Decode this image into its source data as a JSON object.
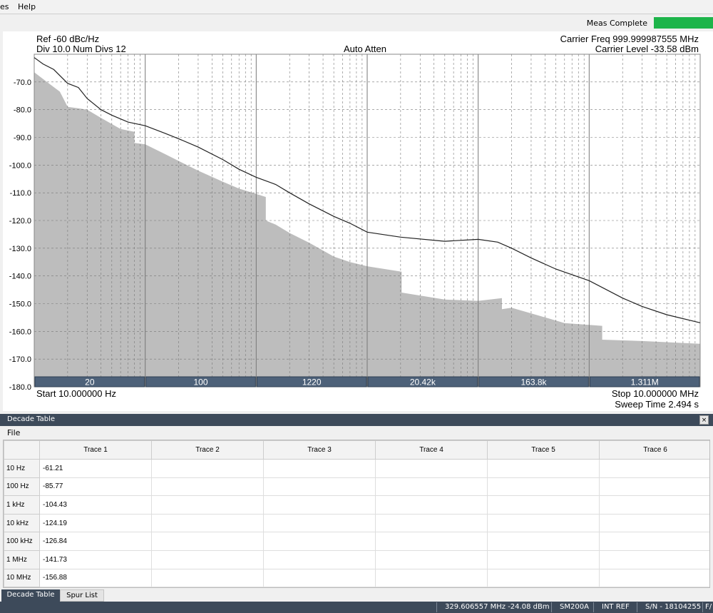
{
  "menubar": {
    "items": [
      "es",
      "Help"
    ]
  },
  "status": {
    "meas_label": "Meas Complete",
    "meas_color": "#1db44a"
  },
  "plot": {
    "ref": "Ref -60 dBc/Hz",
    "div": "Div 10.0 Num Divs 12",
    "auto_atten": "Auto Atten",
    "carrier_freq": "Carrier Freq 999.999987555 MHz",
    "carrier_level": "Carrier Level -33.58 dBm",
    "start": "Start 10.000000 Hz",
    "stop": "Stop 10.000000 MHz",
    "sweep": "Sweep Time 2.494 s",
    "decade_labels": [
      "20",
      "100",
      "1220",
      "20.42k",
      "163.8k",
      "1.311M"
    ]
  },
  "chart_data": {
    "type": "area",
    "x_scale": "log",
    "x_range_hz": [
      10,
      10000000
    ],
    "y_range_dbc": [
      -180,
      -60
    ],
    "y_ticks": [
      "-70.0",
      "-80.0",
      "-90.0",
      "-100.0",
      "-110.0",
      "-120.0",
      "-130.0",
      "-140.0",
      "-150.0",
      "-160.0",
      "-170.0",
      "-180.0"
    ],
    "grid": true,
    "series": [
      {
        "kind": "line",
        "color": "#222222",
        "points": [
          [
            10,
            -61.2
          ],
          [
            12,
            -63.5
          ],
          [
            15,
            -65.5
          ],
          [
            20,
            -70.5
          ],
          [
            25,
            -72
          ],
          [
            30,
            -76
          ],
          [
            40,
            -80
          ],
          [
            50,
            -82
          ],
          [
            70,
            -84.5
          ],
          [
            100,
            -85.8
          ],
          [
            150,
            -88.5
          ],
          [
            200,
            -90.5
          ],
          [
            300,
            -93.5
          ],
          [
            500,
            -98
          ],
          [
            700,
            -101.5
          ],
          [
            1000,
            -104.4
          ],
          [
            1500,
            -107
          ],
          [
            2000,
            -110
          ],
          [
            3000,
            -114
          ],
          [
            5000,
            -118.5
          ],
          [
            7000,
            -121
          ],
          [
            10000,
            -124.2
          ],
          [
            20000,
            -126
          ],
          [
            50000,
            -127.5
          ],
          [
            100000,
            -126.8
          ],
          [
            150000,
            -127.8
          ],
          [
            200000,
            -130
          ],
          [
            300000,
            -133.5
          ],
          [
            500000,
            -137.5
          ],
          [
            1000000,
            -141.7
          ],
          [
            2000000,
            -148
          ],
          [
            3000000,
            -151
          ],
          [
            5000000,
            -154
          ],
          [
            10000000,
            -156.9
          ]
        ]
      },
      {
        "kind": "area",
        "color": "#bdbdbd",
        "points": [
          [
            10,
            -66.5
          ],
          [
            13,
            -70
          ],
          [
            17,
            -73.5
          ],
          [
            20,
            -79
          ],
          [
            25,
            -79.5
          ],
          [
            30,
            -80
          ],
          [
            40,
            -83
          ],
          [
            60,
            -87
          ],
          [
            80,
            -88
          ],
          [
            80,
            -92
          ],
          [
            100,
            -92.5
          ],
          [
            150,
            -96
          ],
          [
            200,
            -98.5
          ],
          [
            300,
            -102
          ],
          [
            500,
            -106
          ],
          [
            700,
            -108.5
          ],
          [
            1220,
            -111.5
          ],
          [
            1220,
            -120
          ],
          [
            1500,
            -121.5
          ],
          [
            2000,
            -124.5
          ],
          [
            3000,
            -128
          ],
          [
            5000,
            -133
          ],
          [
            7000,
            -135
          ],
          [
            10000,
            -136.5
          ],
          [
            20420,
            -138.5
          ],
          [
            20420,
            -146
          ],
          [
            50000,
            -148.5
          ],
          [
            100000,
            -149
          ],
          [
            163800,
            -148
          ],
          [
            163800,
            -152
          ],
          [
            200000,
            -151.5
          ],
          [
            300000,
            -153.5
          ],
          [
            600000,
            -157
          ],
          [
            1311000,
            -158
          ],
          [
            1311000,
            -163
          ],
          [
            3000000,
            -163.5
          ],
          [
            10000000,
            -164.5
          ]
        ]
      }
    ]
  },
  "decade_table": {
    "title": "Decade Table",
    "close_label": "×",
    "menu_file": "File",
    "columns": [
      "Trace 1",
      "Trace 2",
      "Trace 3",
      "Trace 4",
      "Trace 5",
      "Trace 6"
    ],
    "rows": [
      {
        "label": "10 Hz",
        "values": [
          "-61.21",
          "",
          "",
          "",
          "",
          ""
        ]
      },
      {
        "label": "100 Hz",
        "values": [
          "-85.77",
          "",
          "",
          "",
          "",
          ""
        ]
      },
      {
        "label": "1 kHz",
        "values": [
          "-104.43",
          "",
          "",
          "",
          "",
          ""
        ]
      },
      {
        "label": "10 kHz",
        "values": [
          "-124.19",
          "",
          "",
          "",
          "",
          ""
        ]
      },
      {
        "label": "100 kHz",
        "values": [
          "-126.84",
          "",
          "",
          "",
          "",
          ""
        ]
      },
      {
        "label": "1 MHz",
        "values": [
          "-141.73",
          "",
          "",
          "",
          "",
          ""
        ]
      },
      {
        "label": "10 MHz",
        "values": [
          "-156.88",
          "",
          "",
          "",
          "",
          ""
        ]
      }
    ]
  },
  "tabs": [
    "Decade Table",
    "Spur List"
  ],
  "statusbar": {
    "freq": "329.606557 MHz -24.08 dBm",
    "device": "SM200A",
    "ref": "INT REF",
    "serial": "S/N - 18104255",
    "extra": "F/"
  }
}
